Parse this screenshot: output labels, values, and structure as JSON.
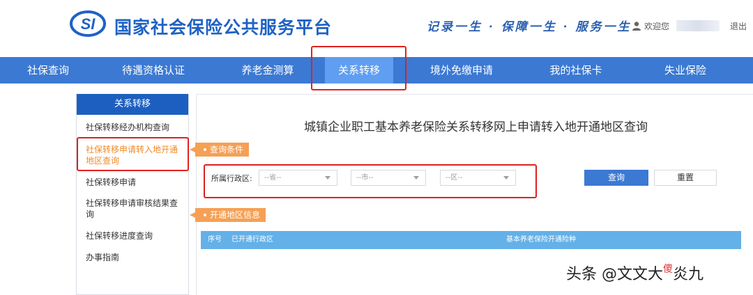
{
  "header": {
    "title": "国家社会保险公共服务平台",
    "slogan": "记录一生 · 保障一生 · 服务一生",
    "welcome": "欢迎您",
    "logout": "退出",
    "brand_color": "#1f62c4"
  },
  "nav": {
    "items": [
      {
        "label": "社保查询"
      },
      {
        "label": "待遇资格认证"
      },
      {
        "label": "养老金测算"
      },
      {
        "label": "关系转移",
        "active": true
      },
      {
        "label": "境外免缴申请"
      },
      {
        "label": "我的社保卡"
      },
      {
        "label": "失业保险"
      }
    ],
    "bar_color": "#3b79d3",
    "active_color": "#5f9ef0"
  },
  "sidebar": {
    "heading": "关系转移",
    "items": [
      {
        "label": "社保转移经办机构查询"
      },
      {
        "label": "社保转移申请转入地开通地区查询",
        "active": true
      },
      {
        "label": "社保转移申请"
      },
      {
        "label": "社保转移申请审核结果查询"
      },
      {
        "label": "社保转移进度查询"
      },
      {
        "label": "办事指南"
      }
    ]
  },
  "main": {
    "title": "城镇企业职工基本养老保险关系转移网上申请转入地开通地区查询",
    "query_section": "查询条件",
    "region_label": "所属行政区:",
    "selects": {
      "province": "--省--",
      "city": "--市--",
      "district": "--区--"
    },
    "query_button": "查询",
    "reset_button": "重置",
    "result_section": "开通地区信息",
    "table_headers": [
      "序号",
      "已开通行政区",
      "基本养老保险开通险种"
    ],
    "accent_color": "#f5a054"
  },
  "watermark": {
    "prefix": "头条 @文文大",
    "accent": "傻",
    "suffix": "炎九"
  }
}
